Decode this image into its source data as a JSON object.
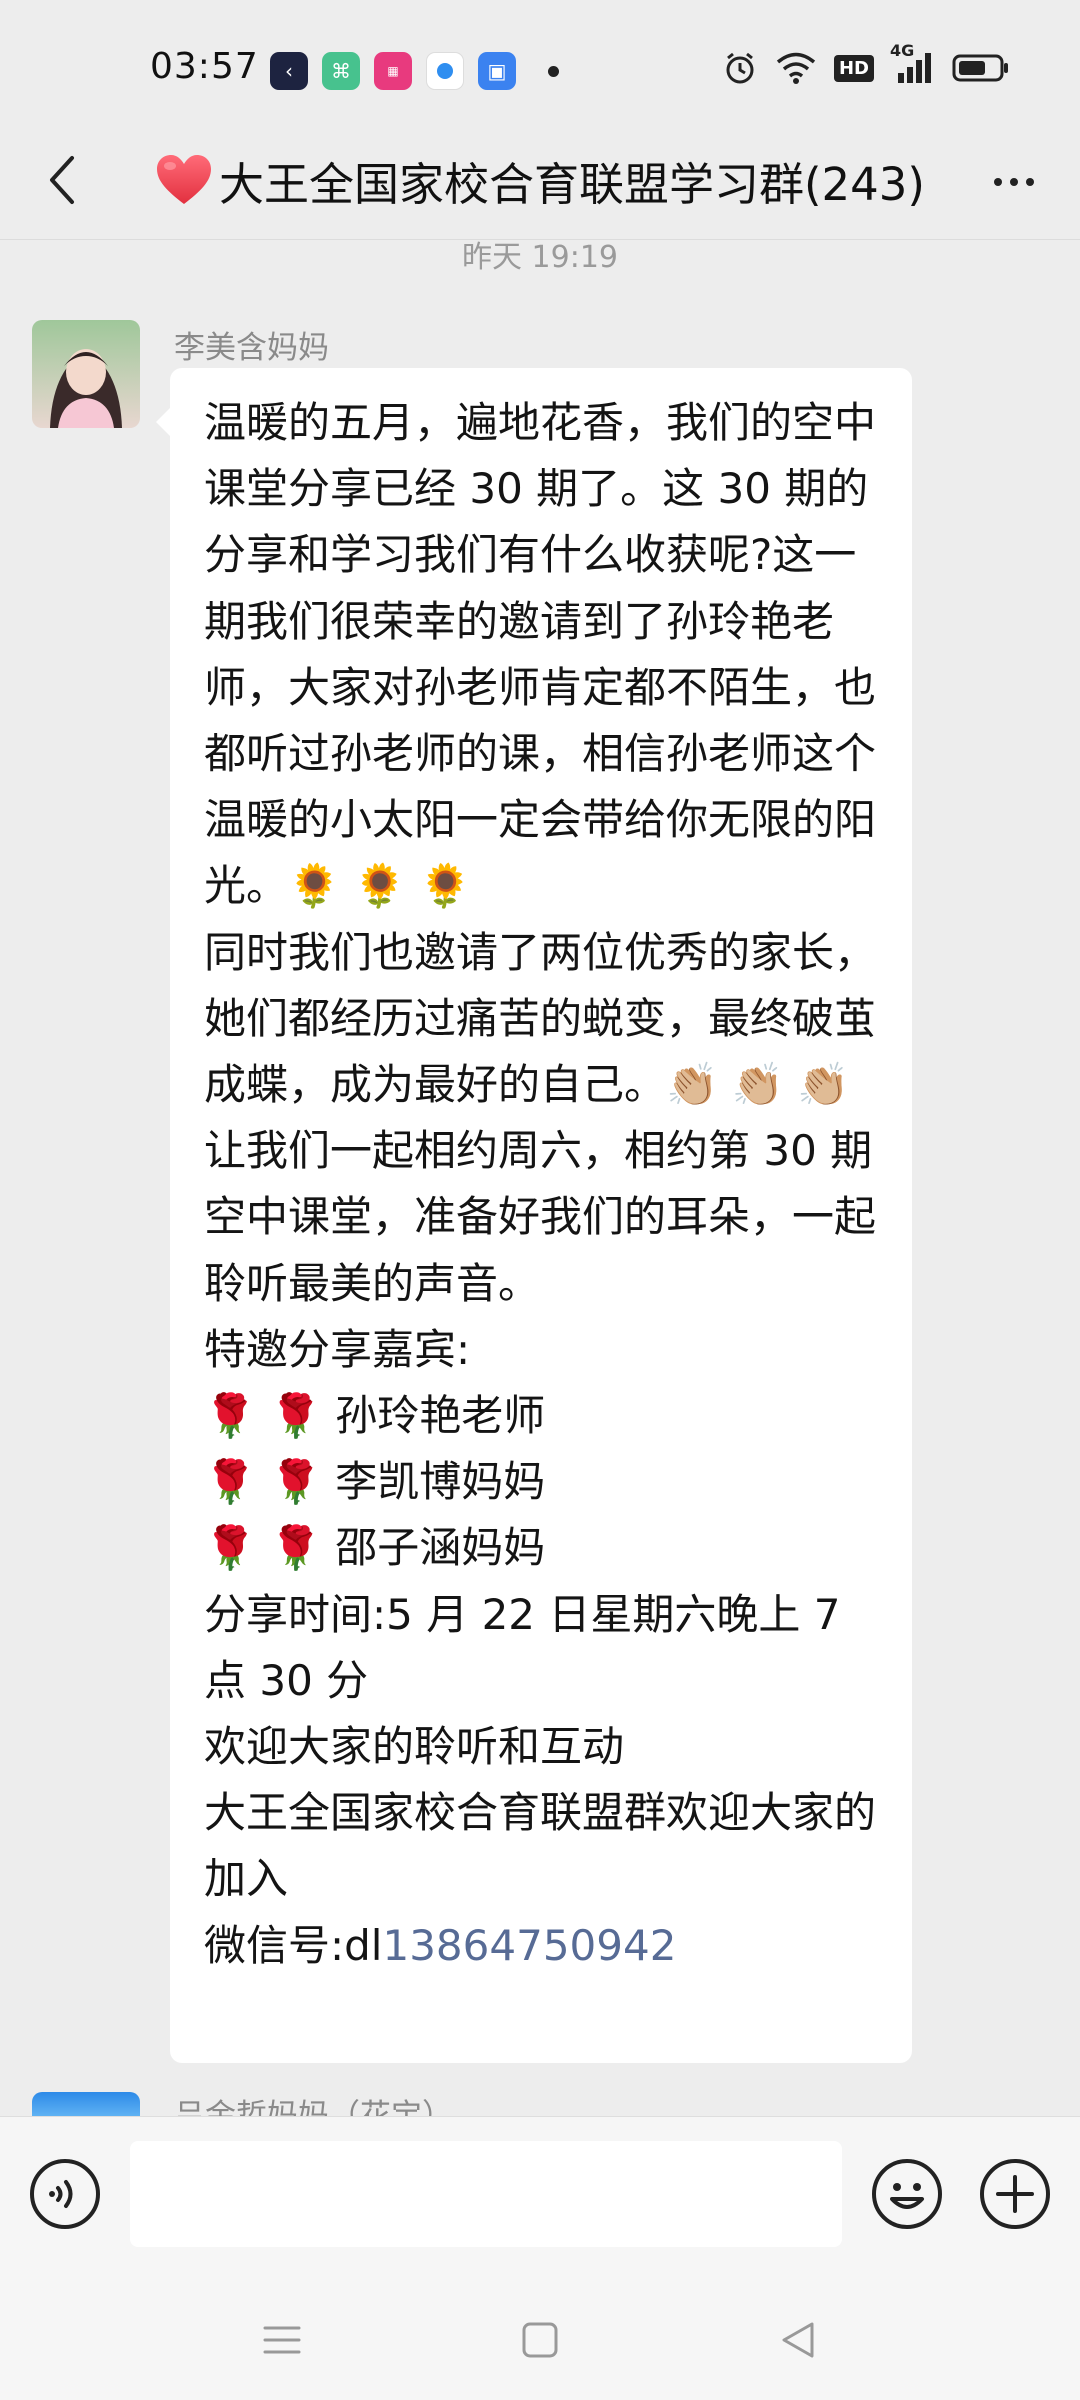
{
  "status_bar": {
    "time": "03:57",
    "network": "4G",
    "hd_label": "HD"
  },
  "header": {
    "title": "大王全国家校合育联盟学习群(243)",
    "title_icon": "red-heart",
    "back_icon": "chevron-left-icon",
    "more_icon": "more-dots-icon"
  },
  "chat": {
    "timestamp": "昨天 19:19",
    "messages": [
      {
        "sender": "李美含妈妈",
        "text": "温暖的五月，遍地花香，我们的空中课堂分享已经 30 期了。这 30 期的分享和学习我们有什么收获呢?这一期我们很荣幸的邀请到了孙玲艳老师，大家对孙老师肯定都不陌生，也都听过孙老师的课，相信孙老师这个温暖的小太阳一定会带给你无限的阳光。🌻 🌻 🌻\n同时我们也邀请了两位优秀的家长，她们都经历过痛苦的蜕变，最终破茧成蝶，成为最好的自己。👏🏼 👏🏼 👏🏼\n让我们一起相约周六，相约第 30 期空中课堂，准备好我们的耳朵，一起聆听最美的声音。\n特邀分享嘉宾:\n🌹 🌹 孙玲艳老师\n🌹 🌹 李凯博妈妈\n🌹 🌹 邵子涵妈妈\n分享时间:5 月 22 日星期六晚上 7 点 30 分\n欢迎大家的聆听和互动\n大王全国家校合育联盟群欢迎大家的加入",
        "wechat_prefix": "微信号:dl",
        "wechat_number": "13864750942"
      }
    ],
    "next_sender": "吕金哲妈妈（花宝）"
  },
  "input_bar": {
    "placeholder": "",
    "voice_icon": "voice-icon",
    "emoji_icon": "emoji-icon",
    "plus_icon": "plus-icon"
  },
  "nav_bar": {
    "menu_icon": "menu-icon",
    "home_icon": "home-icon",
    "back_icon": "back-triangle-icon"
  },
  "colors": {
    "background": "#ededed",
    "bubble": "#ffffff",
    "link": "#576b95",
    "heart": "#e8424f"
  }
}
